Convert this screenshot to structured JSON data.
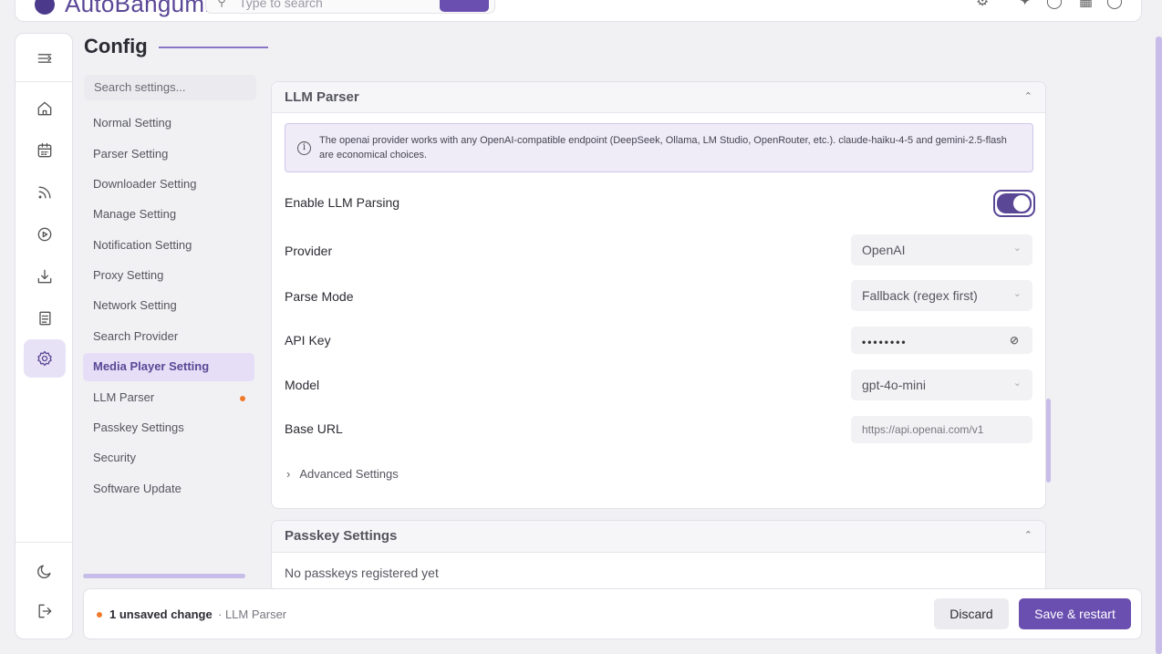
{
  "app": {
    "name": "AutoBangumi"
  },
  "top_search": {
    "placeholder": "Type to search"
  },
  "page": {
    "title": "Config"
  },
  "settings_search": {
    "placeholder": "Search settings..."
  },
  "nav": {
    "items": [
      {
        "label": "Normal Setting"
      },
      {
        "label": "Parser Setting"
      },
      {
        "label": "Downloader Setting"
      },
      {
        "label": "Manage Setting"
      },
      {
        "label": "Notification Setting"
      },
      {
        "label": "Proxy Setting"
      },
      {
        "label": "Network Setting"
      },
      {
        "label": "Search Provider"
      },
      {
        "label": "Media Player Setting",
        "active": true
      },
      {
        "label": "LLM Parser",
        "unsaved": true
      },
      {
        "label": "Passkey Settings"
      },
      {
        "label": "Security"
      },
      {
        "label": "Software Update"
      }
    ]
  },
  "llm_panel": {
    "title": "LLM Parser",
    "info": "The openai provider works with any OpenAI-compatible endpoint (DeepSeek, Ollama, LM Studio, OpenRouter, etc.). claude-haiku-4-5 and gemini-2.5-flash are economical choices.",
    "enable_label": "Enable LLM Parsing",
    "enabled": true,
    "provider_label": "Provider",
    "provider_value": "OpenAI",
    "parse_mode_label": "Parse Mode",
    "parse_mode_value": "Fallback (regex first)",
    "api_key_label": "API Key",
    "api_key_value": "••••••••",
    "model_label": "Model",
    "model_value": "gpt-4o-mini",
    "base_url_label": "Base URL",
    "base_url_value": "https://api.openai.com/v1",
    "advanced_label": "Advanced Settings"
  },
  "passkey_panel": {
    "title": "Passkey Settings",
    "empty_text": "No passkeys registered yet"
  },
  "footer": {
    "unsaved_count": "1 unsaved change",
    "unsaved_section": "· LLM Parser",
    "discard_label": "Discard",
    "save_label": "Save & restart"
  },
  "colors": {
    "accent": "#6a4fb0",
    "accent_light": "#e6def6",
    "unsaved_dot": "#f07a2c"
  }
}
